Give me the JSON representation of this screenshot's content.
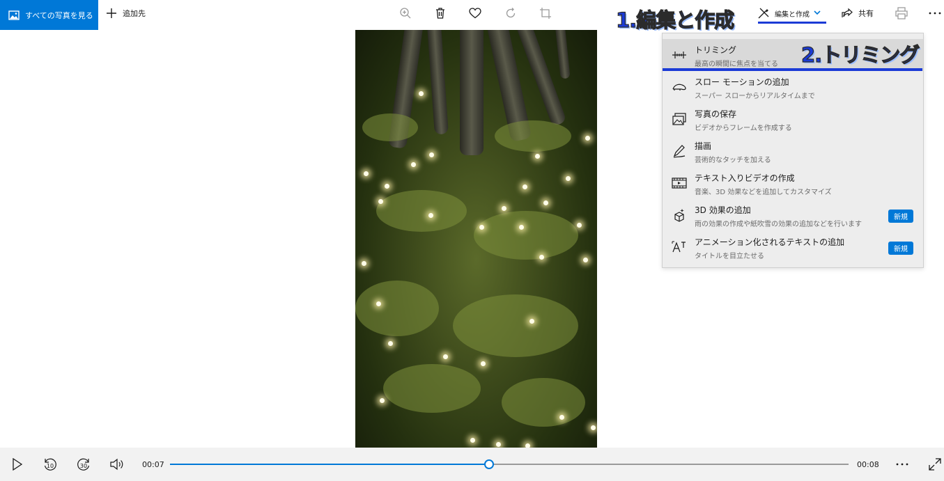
{
  "toolbar": {
    "all_photos_label": "すべての写真を見る",
    "add_to_label": "追加先",
    "edit_create_label": "編集と作成",
    "share_label": "共有",
    "icons": [
      "zoom-icon",
      "delete-icon",
      "favorite-icon",
      "rotate-icon",
      "crop-icon",
      "print-icon",
      "more-icon"
    ]
  },
  "annotations": {
    "step1": "1.編集と作成",
    "step2": "2.トリミング",
    "color": "#1b3bd6"
  },
  "menu": {
    "items": [
      {
        "title": "トリミング",
        "subtitle": "最高の瞬間に焦点を当てる",
        "icon": "trim-icon",
        "highlighted": true
      },
      {
        "title": "スロー モーションの追加",
        "subtitle": "スーパー スローからリアルタイムまで",
        "icon": "slow-motion-icon"
      },
      {
        "title": "写真の保存",
        "subtitle": "ビデオからフレームを作成する",
        "icon": "save-photo-icon"
      },
      {
        "title": "描画",
        "subtitle": "芸術的なタッチを加える",
        "icon": "draw-icon"
      },
      {
        "title": "テキスト入りビデオの作成",
        "subtitle": "音楽、3D 効果などを追加してカスタマイズ",
        "icon": "video-text-icon"
      },
      {
        "title": "3D 効果の追加",
        "subtitle": "雨の効果の作成や紙吹雪の効果の追加などを行います",
        "icon": "3d-effects-icon",
        "badge": "新規"
      },
      {
        "title": "アニメーション化されるテキストの追加",
        "subtitle": "タイトルを目立たせる",
        "icon": "animated-text-icon",
        "badge": "新規"
      }
    ]
  },
  "player": {
    "current_time": "00:07",
    "total_time": "00:08",
    "progress": 0.47,
    "rewind_label": "10",
    "forward_label": "30",
    "accent": "#0078d7"
  }
}
